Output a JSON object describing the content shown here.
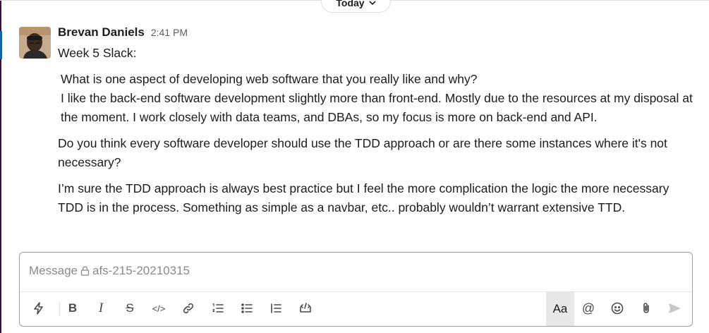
{
  "day_divider": {
    "label": "Today"
  },
  "message": {
    "sender": "Brevan Daniels",
    "time": "2:41 PM",
    "paragraphs": {
      "p1": "Week 5 Slack:",
      "p2a": "What is one aspect of developing web software that you really like and why?",
      "p2b": "I like the back-end software development slightly more than front-end. Mostly due to the resources at my disposal at the moment. I work closely with data teams, and DBAs, so my focus is more on back-end and API.",
      "p3": "Do you think every software developer should use the TDD approach or are there some instances where it's not necessary?",
      "p4": "I’m sure the TDD approach is always best practice but I feel the more complication the logic the more necessary TDD is in the process. Something as simple as a navbar, etc.. probably wouldn’t warrant extensive TTD."
    }
  },
  "composer": {
    "placeholder_prefix": "Message",
    "channel": "afs-215-20210315",
    "toolbar": {
      "bold": "B",
      "italic": "I",
      "strike": "S",
      "code": "</>",
      "aa": "Aa",
      "mention": "@"
    }
  },
  "icons": [
    "lightning-icon",
    "bold-icon",
    "italic-icon",
    "strikethrough-icon",
    "code-icon",
    "link-icon",
    "ordered-list-icon",
    "bulleted-list-icon",
    "blockquote-icon",
    "code-block-icon",
    "text-format-icon",
    "mention-icon",
    "emoji-icon",
    "attach-icon",
    "send-icon",
    "lock-icon"
  ]
}
